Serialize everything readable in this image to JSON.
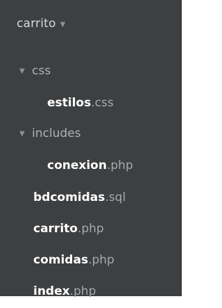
{
  "project": {
    "name": "carrito",
    "dropdown_icon": "caret-down-icon"
  },
  "tree": {
    "css_folder": {
      "label": "css",
      "icon": "chevron-down-icon"
    },
    "estilos": {
      "base": "estilos",
      "ext": ".css"
    },
    "includes_folder": {
      "label": "includes",
      "icon": "chevron-down-icon"
    },
    "conexion": {
      "base": "conexion",
      "ext": ".php"
    },
    "bdcomidas": {
      "base": "bdcomidas",
      "ext": ".sql"
    },
    "carrito": {
      "base": "carrito",
      "ext": ".php"
    },
    "comidas": {
      "base": "comidas",
      "ext": ".php"
    },
    "index": {
      "base": "index",
      "ext": ".php"
    }
  },
  "colors": {
    "panel_bg": "#3d3f41",
    "filename": "#ffffff",
    "extension": "#a7a9ab",
    "folder": "#aeb0b2"
  }
}
